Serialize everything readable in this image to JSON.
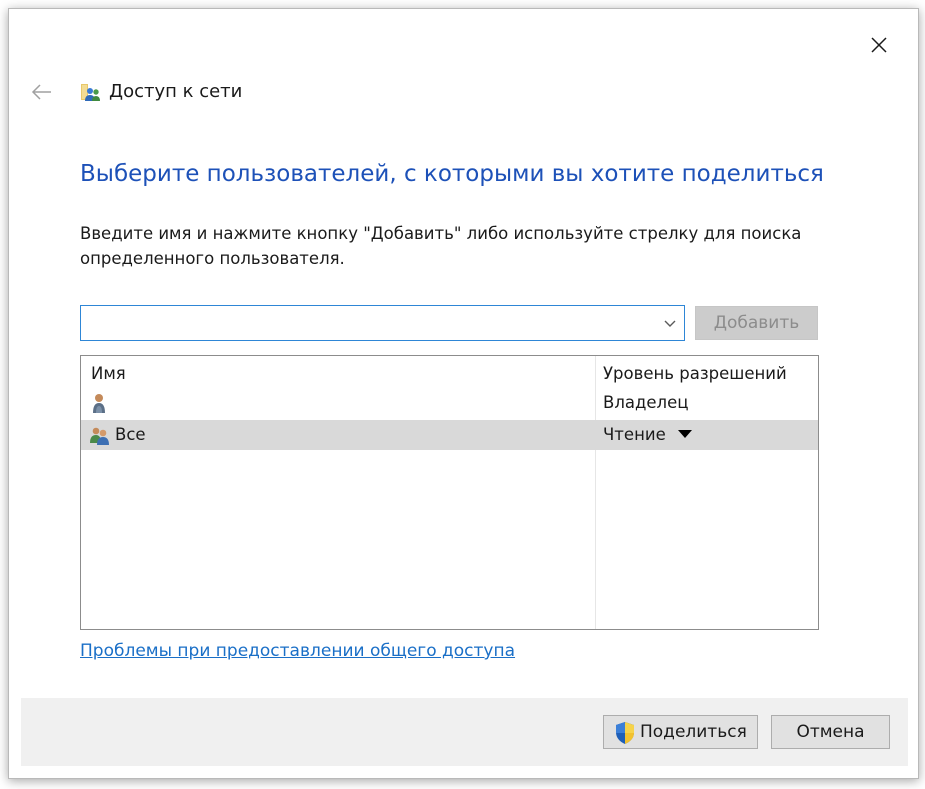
{
  "window": {
    "title": "Доступ к сети",
    "close_icon": "close-icon",
    "back_icon": "back-arrow-icon"
  },
  "main": {
    "heading": "Выберите пользователей, с которыми вы хотите поделиться",
    "instruction": "Введите имя и нажмите кнопку \"Добавить\" либо используйте стрелку для поиска определенного пользователя.",
    "search": {
      "value": "",
      "placeholder": ""
    },
    "add_button_label": "Добавить",
    "add_button_enabled": false
  },
  "table": {
    "columns": [
      "Имя",
      "Уровень разрешений"
    ],
    "rows": [
      {
        "icon": "user-icon",
        "name": "",
        "permission": "Владелец",
        "selected": false
      },
      {
        "icon": "group-icon",
        "name": "Все",
        "permission": "Чтение",
        "selected": true,
        "has_dropdown": true
      }
    ]
  },
  "help_link": "Проблемы при предоставлении общего доступа",
  "footer": {
    "share_label": "Поделиться",
    "share_icon": "uac-shield-icon",
    "cancel_label": "Отмена"
  },
  "colors": {
    "heading": "#1d51b8",
    "link": "#1a6fc7",
    "footer_bg": "#f0f0f0",
    "selected_row": "#d9d9d9",
    "combo_border": "#2e86d6"
  }
}
